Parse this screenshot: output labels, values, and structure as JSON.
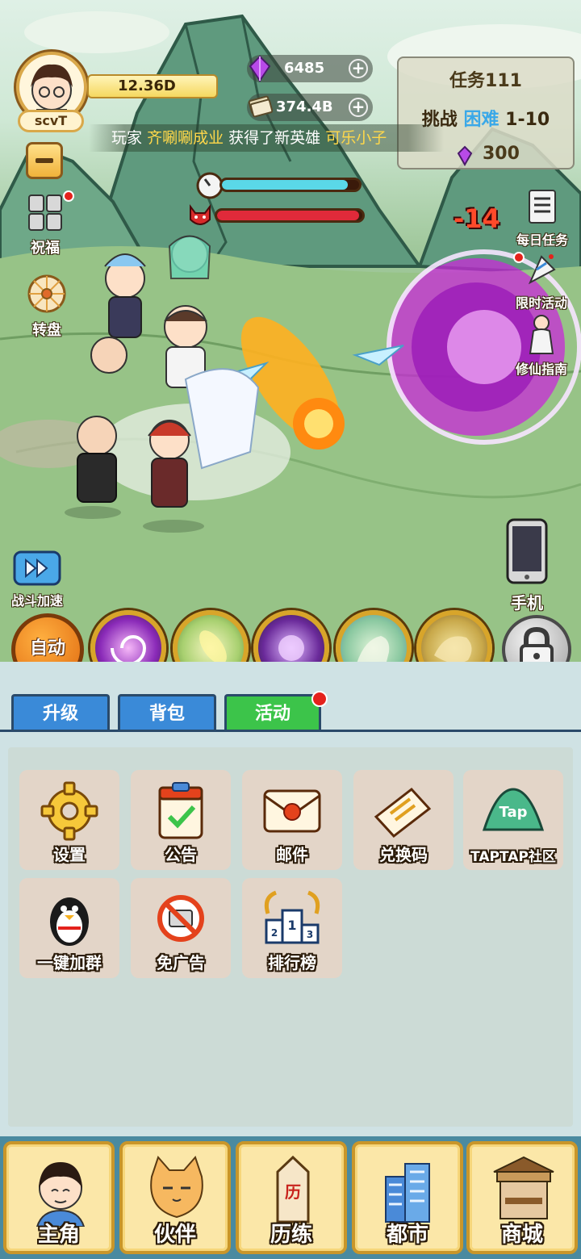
{
  "player": {
    "name": "scvT",
    "gold": "12.36D"
  },
  "resources": {
    "gems": "6485",
    "money": "374.4B"
  },
  "task": {
    "title": "任务111",
    "challenge_prefix": "挑战",
    "difficulty": "困难",
    "stage": "1-10",
    "reward": "300"
  },
  "broadcast": {
    "prefix": "玩家",
    "player": "齐唰唰成业",
    "middle": "获得了新英雄",
    "hero": "可乐小子"
  },
  "battle": {
    "timer_fill": 0.92,
    "enemy_hp_fill": 0.98,
    "damage_text": "-14"
  },
  "left_menu": {
    "blessing": "祝福",
    "wheel": "转盘",
    "speed_up": "战斗加速"
  },
  "right_menu": {
    "daily_task": "每日任务",
    "limited_event": "限时活动",
    "guide": "修仙指南",
    "phone": "手机"
  },
  "skills": {
    "auto": "自动"
  },
  "tabs": [
    {
      "label": "升级",
      "active": false
    },
    {
      "label": "背包",
      "active": false
    },
    {
      "label": "活动",
      "active": true
    }
  ],
  "grid": [
    {
      "label": "设置",
      "icon": "gear-icon"
    },
    {
      "label": "公告",
      "icon": "clipboard-icon"
    },
    {
      "label": "邮件",
      "icon": "mail-icon"
    },
    {
      "label": "兑换码",
      "icon": "ticket-icon"
    },
    {
      "label": "TAPTAP社区",
      "icon": "taptap-icon"
    },
    {
      "label": "一键加群",
      "icon": "penguin-icon"
    },
    {
      "label": "免广告",
      "icon": "no-ads-icon"
    },
    {
      "label": "排行榜",
      "icon": "podium-icon"
    }
  ],
  "bottom_nav": [
    {
      "label": "主角",
      "icon": "hero-icon"
    },
    {
      "label": "伙伴",
      "icon": "cat-icon"
    },
    {
      "label": "历练",
      "icon": "calendar-icon"
    },
    {
      "label": "都市",
      "icon": "city-icon"
    },
    {
      "label": "商城",
      "icon": "shop-icon"
    }
  ],
  "colors": {
    "gold": "#d8a52a",
    "tab_active": "#3cc44a",
    "tab_inactive": "#3a8ad8",
    "alert": "#e4221c"
  }
}
